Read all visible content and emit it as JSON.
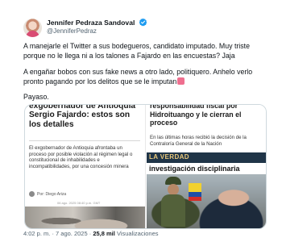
{
  "author": {
    "display_name": "Jennifer Pedraza Sandoval",
    "handle": "@JenniferPedraz"
  },
  "tweet": {
    "paragraph_1": "A manejarle el Twitter a sus bodegueros, candidato imputado. Muy triste porque no le llega ni a los talones a Fajardo en las encuestas? Jaja",
    "paragraph_2": "A engañar bobos con sus fake news a otro lado, politiquero. Anhelo verlo pronto pagando por los delitos que se le imputan",
    "paragraph_3": "Payaso."
  },
  "media": {
    "left": {
      "title": "exgobernador de Antioquia Sergio Fajardo: estos son los detalles",
      "body": "El exgobernador de Antioquia afrontaba un proceso por posible violación al régimen legal o constitucional de inhabilidades e incompatibilidades, por una concesión minera",
      "byline": "Por: Diego Ariza",
      "caption": "06 ago. 2025 08:40 p.m. GMT"
    },
    "right": {
      "title": "responsabilidad fiscal por Hidroituango y le cierran el proceso",
      "body": "En las últimas horas recibió la decisión de la Contraloría General de la Nación",
      "overlay_banner": "LA VERDAD",
      "overlay_title": "investigación disciplinaria"
    }
  },
  "meta": {
    "time": "4:02 p. m.",
    "date": "7 ago. 2025",
    "views_count": "25,8 mil",
    "views_label": "Visualizaciones"
  },
  "colors": {
    "verified": "#1d9bf0",
    "text": "#0f1419",
    "muted": "#536471"
  }
}
